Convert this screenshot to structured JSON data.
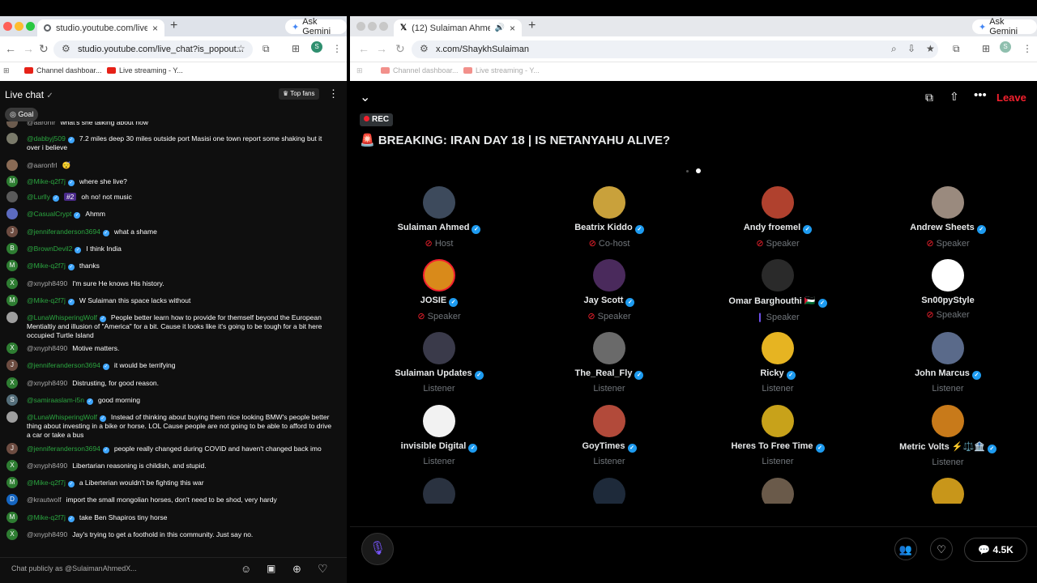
{
  "left_window": {
    "tab": {
      "title": "studio.youtube.com/live_chat"
    },
    "ask_gemini": "Ask Gemini",
    "url": "studio.youtube.com/live_chat?is_popout...",
    "bookmarks": [
      "Channel dashboar...",
      "Live streaming - Y..."
    ],
    "chat": {
      "title": "Live chat",
      "top_fans_label": "Top fans",
      "goal_label": "Goal",
      "messages": [
        {
          "author": "@aaronfr",
          "text": "what's she talking about now",
          "avatar": "",
          "avatar_color": "#6b5b4e"
        },
        {
          "author": "@dabbyj509",
          "text": "7.2 miles deep 30 miles outside port Masisi one town report some shaking but it over i believe",
          "avatar": "",
          "avatar_color": "#7a7a6a"
        },
        {
          "author": "@aaronfrl",
          "text": "😴",
          "avatar": "",
          "avatar_color": "#8a6b55"
        },
        {
          "author": "@Mike-q2f7j",
          "text": "where she live?",
          "avatar": "M",
          "avatar_color": "#2e7d32"
        },
        {
          "author": "@Lurlly",
          "text": "oh no! not music",
          "avatar": "",
          "avatar_color": "#5a5a5a",
          "badge": "#2"
        },
        {
          "author": "@CasualCrypt",
          "text": "Ahmm",
          "avatar": "",
          "avatar_color": "#5c6bc0"
        },
        {
          "author": "@jenniferanderson3694",
          "text": "what a shame",
          "avatar": "J",
          "avatar_color": "#6d4c41"
        },
        {
          "author": "@BrownDevil2",
          "text": "I think India",
          "avatar": "B",
          "avatar_color": "#2e7d32"
        },
        {
          "author": "@Mike-q2f7j",
          "text": "thanks",
          "avatar": "M",
          "avatar_color": "#2e7d32"
        },
        {
          "author": "@xnyph8490",
          "text": "I'm sure He knows His history.",
          "avatar": "X",
          "avatar_color": "#2e7d32"
        },
        {
          "author": "@Mike-q2f7j",
          "text": "W Sulaiman this space lacks without",
          "avatar": "M",
          "avatar_color": "#2e7d32"
        },
        {
          "author": "@LunaWhisperingWolf",
          "text": "People better learn how to provide for themself beyond the European Mentialtiy and illusion of \"America\" for a bit. Cause it looks like it's going to be tough for a bit here occupied Turtle Island",
          "avatar": "",
          "avatar_color": "#9e9e9e"
        },
        {
          "author": "@xnyph8490",
          "text": "Motive matters.",
          "avatar": "X",
          "avatar_color": "#2e7d32"
        },
        {
          "author": "@jenniferanderson3694",
          "text": "it would be terrifying",
          "avatar": "J",
          "avatar_color": "#6d4c41"
        },
        {
          "author": "@xnyph8490",
          "text": "Distrusting, for good reason.",
          "avatar": "X",
          "avatar_color": "#2e7d32"
        },
        {
          "author": "@samiraaslam-i5n",
          "text": "good morning",
          "avatar": "S",
          "avatar_color": "#546e7a"
        },
        {
          "author": "@LunaWhisperingWolf",
          "text": "Instead of thinking about buying them nice looking BMW's people better thing about investing in a bike or horse. LOL Cause people are not going to be able to afford to drive a car or take a bus",
          "avatar": "",
          "avatar_color": "#9e9e9e"
        },
        {
          "author": "@jenniferanderson3694",
          "text": "people really changed during COVID and haven't changed back imo",
          "avatar": "J",
          "avatar_color": "#6d4c41"
        },
        {
          "author": "@xnyph8490",
          "text": "Libertarian reasoning is childish, and stupid.",
          "avatar": "X",
          "avatar_color": "#2e7d32"
        },
        {
          "author": "@Mike-q2f7j",
          "text": "a Liberterian wouldn't be fighting this war",
          "avatar": "M",
          "avatar_color": "#2e7d32"
        },
        {
          "author": "@krautwolf",
          "text": "import the small mongolian horses, don't need to be shod, very hardy",
          "avatar": "D",
          "avatar_color": "#1565c0"
        },
        {
          "author": "@Mike-q2f7j",
          "text": "take Ben Shapiros tiny horse",
          "avatar": "M",
          "avatar_color": "#2e7d32"
        },
        {
          "author": "@xnyph8490",
          "text": "Jay's trying to get a foothold in this community. Just say no.",
          "avatar": "X",
          "avatar_color": "#2e7d32"
        }
      ],
      "input_placeholder": "Chat publicly as @SulaimanAhmedX..."
    }
  },
  "right_window": {
    "tab": {
      "title": "(12) Sulaiman Ahmed (@S..."
    },
    "ask_gemini": "Ask Gemini",
    "url": "x.com/ShaykhSulaiman",
    "bookmarks": [
      "Channel dashboar...",
      "Live streaming - Y..."
    ],
    "space": {
      "leave_label": "Leave",
      "rec_label": "REC",
      "title": "🚨 BREAKING: IRAN DAY 18 | IS NETANYAHU ALIVE?",
      "participants": [
        {
          "name": "Sulaiman Ahmed",
          "role": "Host",
          "role_icon": "mic-off",
          "verified": true,
          "avatar_color": "#3d4a5c"
        },
        {
          "name": "Beatrix Kiddo",
          "role": "Co-host",
          "role_icon": "mic-off",
          "verified": true,
          "avatar_color": "#c9a13b"
        },
        {
          "name": "Andy froemel",
          "role": "Speaker",
          "role_icon": "mic-off",
          "verified": true,
          "avatar_color": "#b0412e"
        },
        {
          "name": "Andrew Sheets",
          "role": "Speaker",
          "role_icon": "mic-off",
          "verified": true,
          "avatar_color": "#9a8a7e"
        },
        {
          "name": "JOSIE",
          "role": "Speaker",
          "role_icon": "mic-off",
          "verified": true,
          "avatar_color": "#d98a1a"
        },
        {
          "name": "Jay Scott",
          "role": "Speaker",
          "role_icon": "mic-off",
          "verified": true,
          "avatar_color": "#4a2a5c"
        },
        {
          "name": "Omar Barghouthi 🇵🇸",
          "role": "Speaker",
          "role_icon": "speaking",
          "verified": true,
          "avatar_color": "#2a2a2a"
        },
        {
          "name": "Sn00pyStyle",
          "role": "Speaker",
          "role_icon": "mic-off",
          "verified": false,
          "avatar_color": "#ffffff"
        },
        {
          "name": "Sulaiman Updates",
          "role": "Listener",
          "role_icon": "",
          "verified": true,
          "avatar_color": "#3a3a4a"
        },
        {
          "name": "The_Real_Fly",
          "role": "Listener",
          "role_icon": "",
          "verified": true,
          "avatar_color": "#6a6a6a"
        },
        {
          "name": "Ricky",
          "role": "Listener",
          "role_icon": "",
          "verified": true,
          "avatar_color": "#e6b422"
        },
        {
          "name": "John Marcus",
          "role": "Listener",
          "role_icon": "",
          "verified": true,
          "avatar_color": "#5a6a8a"
        },
        {
          "name": "invisible Digital",
          "role": "Listener",
          "role_icon": "",
          "verified": true,
          "avatar_color": "#f2f2f2"
        },
        {
          "name": "GoyTimes",
          "role": "Listener",
          "role_icon": "",
          "verified": true,
          "avatar_color": "#b24a3a"
        },
        {
          "name": "Heres To Free Time",
          "role": "Listener",
          "role_icon": "",
          "verified": true,
          "avatar_color": "#c8a21a"
        },
        {
          "name": "Metric Volts ⚡⚖️🏦",
          "role": "Listener",
          "role_icon": "",
          "verified": true,
          "avatar_color": "#c87a1a"
        }
      ],
      "partial_avatars": [
        "#2a3240",
        "#1e2a3a",
        "#6a5a4a",
        "#c8961a"
      ],
      "reply_count": "4.5K"
    }
  }
}
